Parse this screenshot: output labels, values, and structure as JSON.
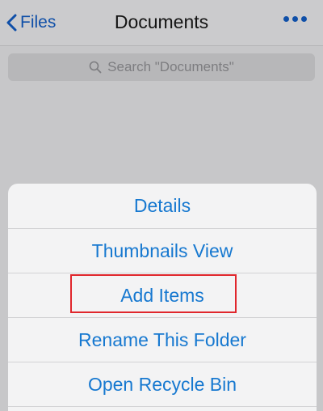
{
  "navbar": {
    "back_label": "Files",
    "title": "Documents",
    "more_icon": "ellipsis-icon"
  },
  "search": {
    "placeholder": "Search \"Documents\""
  },
  "action_sheet": {
    "items": [
      {
        "label": "Details"
      },
      {
        "label": "Thumbnails View"
      },
      {
        "label": "Add Items"
      },
      {
        "label": "Rename This Folder"
      },
      {
        "label": "Open Recycle Bin"
      }
    ],
    "highlighted_item": "Add Items"
  },
  "colors": {
    "accent": "#1678d0",
    "nav_accent": "#0f4fa8",
    "highlight": "#e0262c",
    "backdrop": "#c7c7c9"
  }
}
